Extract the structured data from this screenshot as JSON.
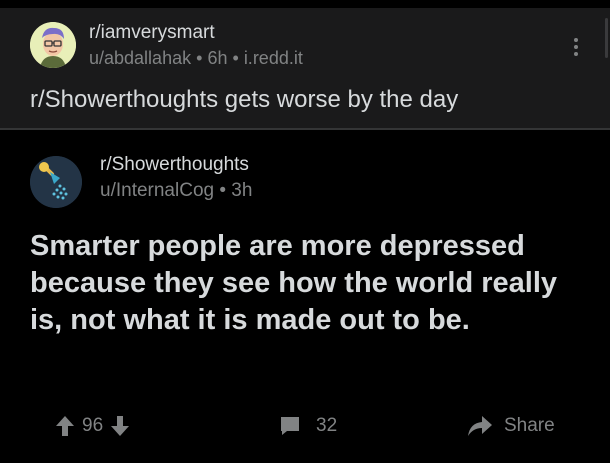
{
  "outer_post": {
    "subreddit": "r/iamverysmart",
    "user": "u/abdallahak",
    "age": "6h",
    "domain": "i.redd.it",
    "separator": "•",
    "title": "r/Showerthoughts gets worse by the day"
  },
  "inner_post": {
    "subreddit": "r/Showerthoughts",
    "user": "u/InternalCog",
    "age": "3h",
    "separator": "•",
    "title": "Smarter people are more depressed because they see how the world really is, not what it is made out to be.",
    "votes": "96",
    "comments": "32",
    "share_label": "Share"
  },
  "icons": {
    "outer_avatar": "cartoon-face-avatar-icon",
    "inner_avatar": "shower-head-icon",
    "more": "kebab-menu-icon",
    "upvote": "upvote-arrow-icon",
    "downvote": "downvote-arrow-icon",
    "comment": "comment-bubble-icon",
    "share": "share-arrow-icon"
  },
  "colors": {
    "outer_bg": "#1a1a1b",
    "inner_bg": "#000000",
    "text": "#d7dadc",
    "meta": "#818384"
  }
}
